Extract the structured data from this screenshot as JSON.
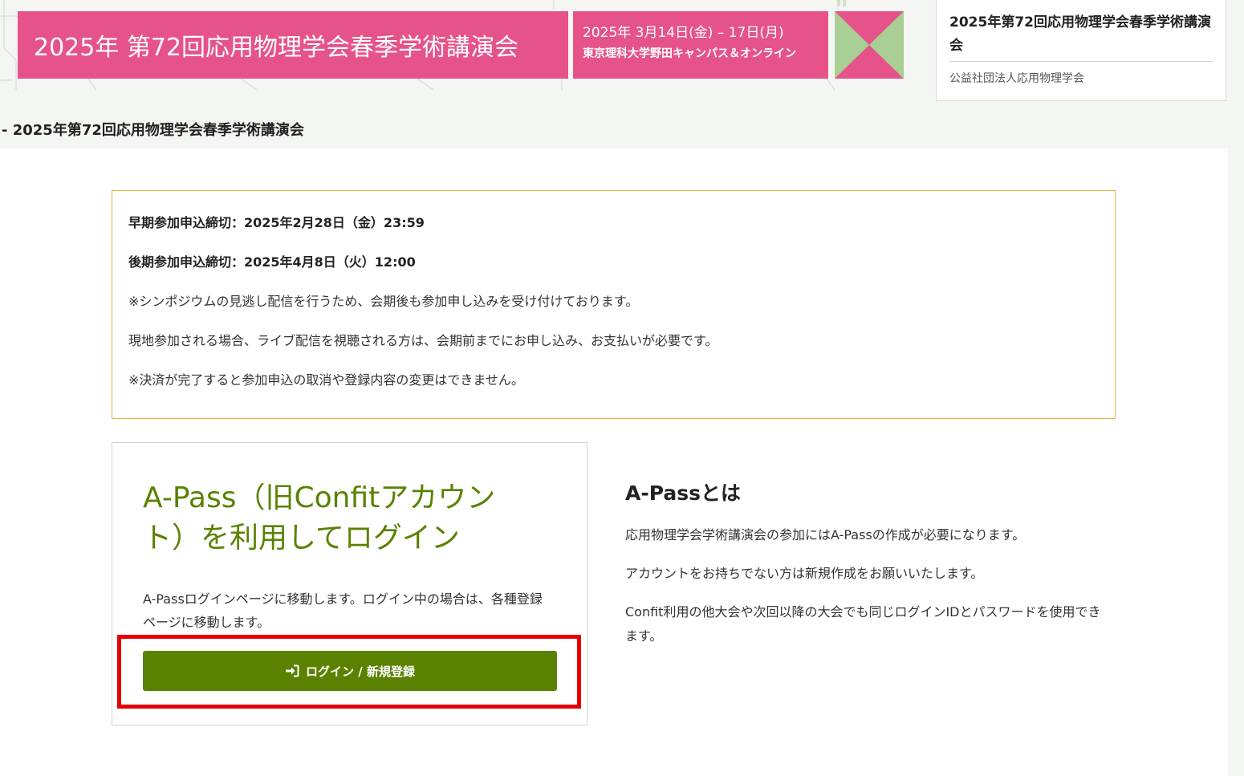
{
  "banner": {
    "title": "2025年 第72回応用物理学会春季学術講演会",
    "date_line": "2025年 3月14日(金) – 17日(月)",
    "venue_line": "東京理科大学野田キャンパス＆オンライン"
  },
  "org_box": {
    "title": "2025年第72回応用物理学会春季学術講演会",
    "subtitle": "公益社団法人応用物理学会"
  },
  "breadcrumb": "- 2025年第72回応用物理学会春季学術講演会",
  "notice": {
    "early_deadline": "早期参加申込締切：2025年2月28日（金）23:59",
    "late_deadline": "後期参加申込締切：2025年4月8日（火）12:00",
    "line3": "※シンポジウムの見逃し配信を行うため、会期後も参加申し込みを受け付けております。",
    "line4": "現地参加される場合、ライブ配信を視聴される方は、会期前までにお申し込み、お支払いが必要です。",
    "line5": "※決済が完了すると参加申込の取消や登録内容の変更はできません。"
  },
  "login_card": {
    "heading": "A-Pass（旧Confitアカウント）を利用してログイン",
    "description": "A-Passログインページに移動します。ログイン中の場合は、各種登録ページに移動します。",
    "button_label": "ログイン / 新規登録",
    "button_icon": "sign-in-icon"
  },
  "apass_info": {
    "heading": "A-Passとは",
    "para1": "応用物理学会学術講演会の参加にはA-Passの作成が必要になります。",
    "para2": "アカウントをお持ちでない方は新規作成をお願いいたします。",
    "para3": "Confit利用の他大会や次回以降の大会でも同じログインIDとパスワードを使用できます。"
  },
  "colors": {
    "banner_pink": "#e6538a",
    "accent_green": "#5a8200",
    "notice_border": "#e3b546",
    "highlight_red": "#e60000"
  }
}
